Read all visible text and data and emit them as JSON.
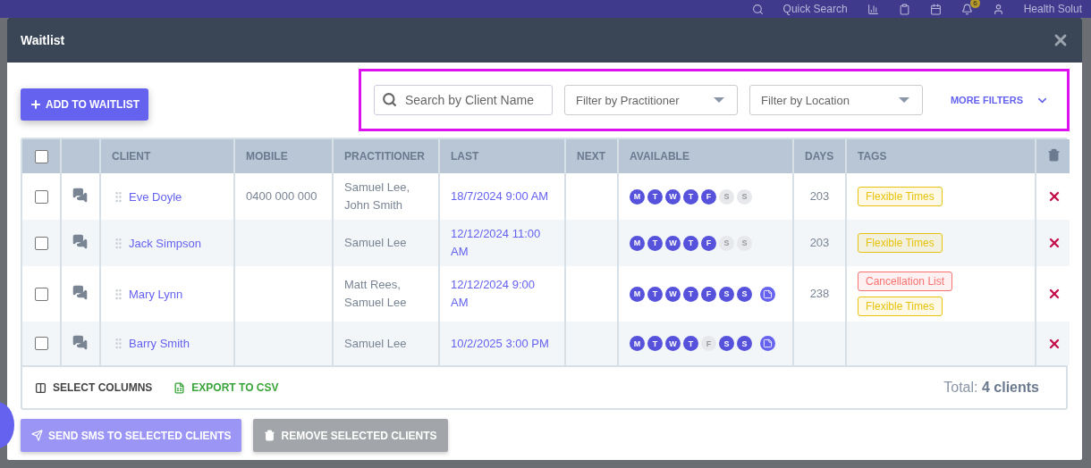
{
  "app_bar": {
    "search_label": "Quick Search",
    "notification_count": "6",
    "account": "Health Solut"
  },
  "dialog": {
    "title": "Waitlist"
  },
  "add_button": "ADD TO WAITLIST",
  "filters": {
    "search": {
      "placeholder": "Search by Client Name"
    },
    "practitioner": {
      "placeholder": "Filter by Practitioner"
    },
    "location": {
      "placeholder": "Filter by Location"
    },
    "more": "MORE FILTERS"
  },
  "table": {
    "select_all": {
      "checked": false
    },
    "columns": [
      "CLIENT",
      "MOBILE",
      "PRACTITIONER",
      "LAST",
      "NEXT",
      "AVAILABLE",
      "DAYS",
      "TAGS"
    ],
    "rows": [
      {
        "checked": false,
        "client": "Eve Doyle",
        "mobile": "0400 000 000",
        "practitioner": "Samuel Lee, John Smith",
        "last": "18/7/2024 9:00 AM",
        "next": "",
        "days_available": [
          {
            "letter": "M",
            "on": true
          },
          {
            "letter": "T",
            "on": true
          },
          {
            "letter": "W",
            "on": true
          },
          {
            "letter": "T",
            "on": true
          },
          {
            "letter": "F",
            "on": true
          },
          {
            "letter": "S",
            "on": false
          },
          {
            "letter": "S",
            "on": false
          }
        ],
        "note": false,
        "days": "203",
        "tags": [
          {
            "label": "Flexible Times",
            "color": "#e8c30c"
          }
        ]
      },
      {
        "checked": false,
        "client": "Jack Simpson",
        "mobile": "",
        "practitioner": "Samuel Lee",
        "last": "12/12/2024 11:00 AM",
        "next": "",
        "days_available": [
          {
            "letter": "M",
            "on": true
          },
          {
            "letter": "T",
            "on": true
          },
          {
            "letter": "W",
            "on": true
          },
          {
            "letter": "T",
            "on": true
          },
          {
            "letter": "F",
            "on": true
          },
          {
            "letter": "S",
            "on": false
          },
          {
            "letter": "S",
            "on": false
          }
        ],
        "note": false,
        "days": "203",
        "tags": [
          {
            "label": "Flexible Times",
            "color": "#e8c30c"
          }
        ]
      },
      {
        "checked": false,
        "client": "Mary Lynn",
        "mobile": "",
        "practitioner": "Matt Rees, Samuel Lee",
        "last": "12/12/2024 9:00 AM",
        "next": "",
        "days_available": [
          {
            "letter": "M",
            "on": true
          },
          {
            "letter": "T",
            "on": true
          },
          {
            "letter": "W",
            "on": true
          },
          {
            "letter": "T",
            "on": true
          },
          {
            "letter": "F",
            "on": true
          },
          {
            "letter": "S",
            "on": true
          },
          {
            "letter": "S",
            "on": true
          }
        ],
        "note": true,
        "days": "238",
        "tags": [
          {
            "label": "Cancellation List",
            "color": "#f87171"
          },
          {
            "label": "Flexible Times",
            "color": "#e8c30c"
          }
        ]
      },
      {
        "checked": false,
        "client": "Barry Smith",
        "mobile": "",
        "practitioner": "Samuel Lee",
        "last": "10/2/2025 3:00 PM",
        "next": "",
        "days_available": [
          {
            "letter": "M",
            "on": true
          },
          {
            "letter": "T",
            "on": true
          },
          {
            "letter": "W",
            "on": true
          },
          {
            "letter": "T",
            "on": true
          },
          {
            "letter": "F",
            "on": false
          },
          {
            "letter": "S",
            "on": true
          },
          {
            "letter": "S",
            "on": true
          }
        ],
        "note": true,
        "days": "",
        "tags": []
      }
    ]
  },
  "footer": {
    "select_columns": "SELECT COLUMNS",
    "export": "EXPORT TO CSV",
    "total_label": "Total:",
    "total_value": "4 clients"
  },
  "actions": [
    "SEND SMS TO SELECTED CLIENTS",
    "REMOVE SELECTED CLIENTS"
  ]
}
